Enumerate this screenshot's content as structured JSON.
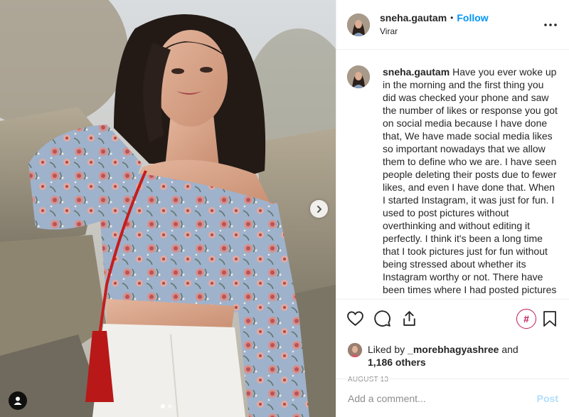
{
  "post": {
    "username": "sneha.gautam",
    "separator": "•",
    "follow_label": "Follow",
    "location": "Virar",
    "more_icon": "more-options-icon"
  },
  "caption": {
    "username": "sneha.gautam",
    "text": "Have you ever woke up in the morning and the first thing you did was checked your phone and saw the number of likes or response you got on social media because I have done that, We have made social media likes so important nowadays that we allow them to define who we are. I have seen people deleting their posts due to fewer likes, and even I have done that. When I started Instagram, it was just for fun. I used to post pictures without overthinking and without editing it perfectly. I think it's been a long time that I took pictures just for fun without being stressed about whether its Instagram worthy or not. There have been times where I had posted pictures even"
  },
  "actions": {
    "like_icon": "heart-icon",
    "comment_icon": "comment-icon",
    "share_icon": "share-icon",
    "hashtag_label": "#",
    "save_icon": "bookmark-icon"
  },
  "likes": {
    "prefix": "Liked by",
    "user": "_morebhagyashree",
    "conj": "and",
    "others": "1,186 others"
  },
  "date": "AUGUST 13",
  "comment_box": {
    "placeholder": "Add a comment...",
    "post_label": "Post"
  },
  "carousel": {
    "slides": 2,
    "active": 0
  },
  "colors": {
    "follow": "#0095f6",
    "post_disabled": "#b2dffc",
    "hashtag": "#c2185b",
    "muted": "#8e8e8e"
  }
}
